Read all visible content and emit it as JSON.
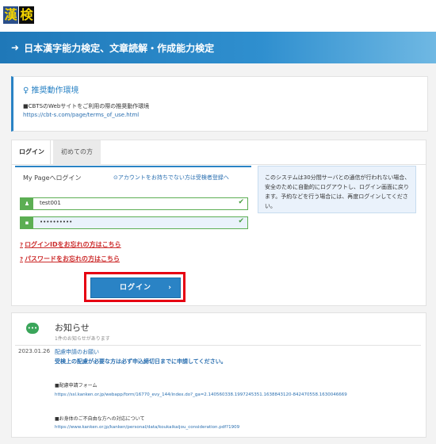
{
  "header": {
    "logo_chars": [
      "漢",
      "検"
    ],
    "banner_icon": "sign-in-icon",
    "banner_title": "日本漢字能力検定、文章読解・作成能力検定"
  },
  "env": {
    "icon": "lightbulb-icon",
    "title": "推奨動作環境",
    "text": "■CBTSのWebサイトをご利用の際の推奨動作環境",
    "link": "https://cbt-s.com/page/terms_of_use.html"
  },
  "tabs": {
    "login": "ログイン",
    "first": "初めての方"
  },
  "login": {
    "mypage_label": "My Pageへログイン",
    "register_link": "⊙アカウントをお持ちでない方は受検者登録へ",
    "user_icon": "user-icon",
    "user_value": "test001",
    "pass_icon": "lock-icon",
    "pass_value": "••••••••••",
    "forgot_id": "ログインIDをお忘れの方はこちら",
    "forgot_pw": "パスワードをお忘れの方はこちら",
    "button_label": "ログイン",
    "button_arrow": "›"
  },
  "notice": {
    "text": "このシステムは30分間サーバとの通信が行われない場合、安全のために自動的にログアウトし、ログイン画面に戻ります。予約などを行う場合には、再度ログインしてください。"
  },
  "news": {
    "icon": "chat-bubble-icon",
    "title": "お知らせ",
    "subtitle": "1件のお知らせがあります",
    "date": "2023.01.26",
    "headline": "配慮申請のお願い",
    "bold_text": "受検上の配慮が必要な方は必ず申込締切日までに申請してください。",
    "item1_title": "■配慮申請フォーム",
    "item1_link": "https://ssl.kanken.or.jp/webapp/form/16770_evy_144/index.do?_ga=2.140560338.1997245351.1638843120-842470558.1630046669",
    "item2_title": "■お身体のご不自由な方への対応について",
    "item2_link": "https://www.kanken.or.jp/kanken/personal/data/koukaikaijou_consideration.pdf?1909"
  },
  "colors": {
    "brand_blue": "#2a83c5",
    "valid_green": "#5cae53",
    "highlight_red": "#e60012",
    "link_red": "#cc2b2b"
  }
}
